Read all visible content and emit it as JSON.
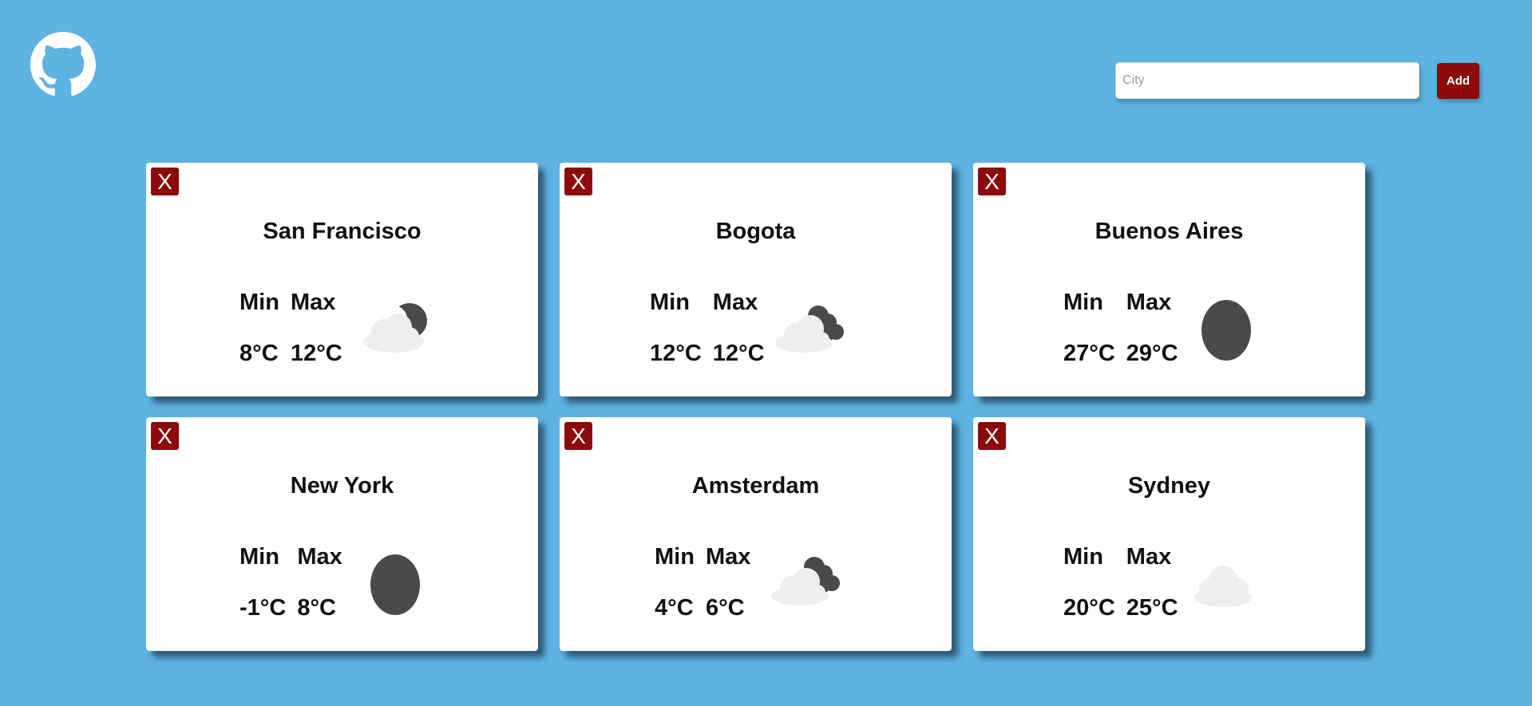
{
  "header": {
    "logo_icon": "github-icon",
    "search_placeholder": "City",
    "search_value": "",
    "add_label": "Add"
  },
  "colors": {
    "background": "#5eb3e2",
    "accent": "#8c0a0a",
    "card": "#ffffff",
    "icon_dark": "#4a4a4a",
    "icon_light": "#eeeeee"
  },
  "labels": {
    "min": "Min",
    "max": "Max",
    "close": "X"
  },
  "cards": [
    {
      "city": "San Francisco",
      "min": "8°C",
      "max": "12°C",
      "icon": "partly-cloudy-night-icon"
    },
    {
      "city": "Bogota",
      "min": "12°C",
      "max": "12°C",
      "icon": "cloudy-night-icon"
    },
    {
      "city": "Buenos Aires",
      "min": "27°C",
      "max": "29°C",
      "icon": "clear-night-icon"
    },
    {
      "city": "New York",
      "min": "-1°C",
      "max": "8°C",
      "icon": "clear-night-icon"
    },
    {
      "city": "Amsterdam",
      "min": "4°C",
      "max": "6°C",
      "icon": "cloudy-night-icon"
    },
    {
      "city": "Sydney",
      "min": "20°C",
      "max": "25°C",
      "icon": "cloud-icon"
    }
  ]
}
